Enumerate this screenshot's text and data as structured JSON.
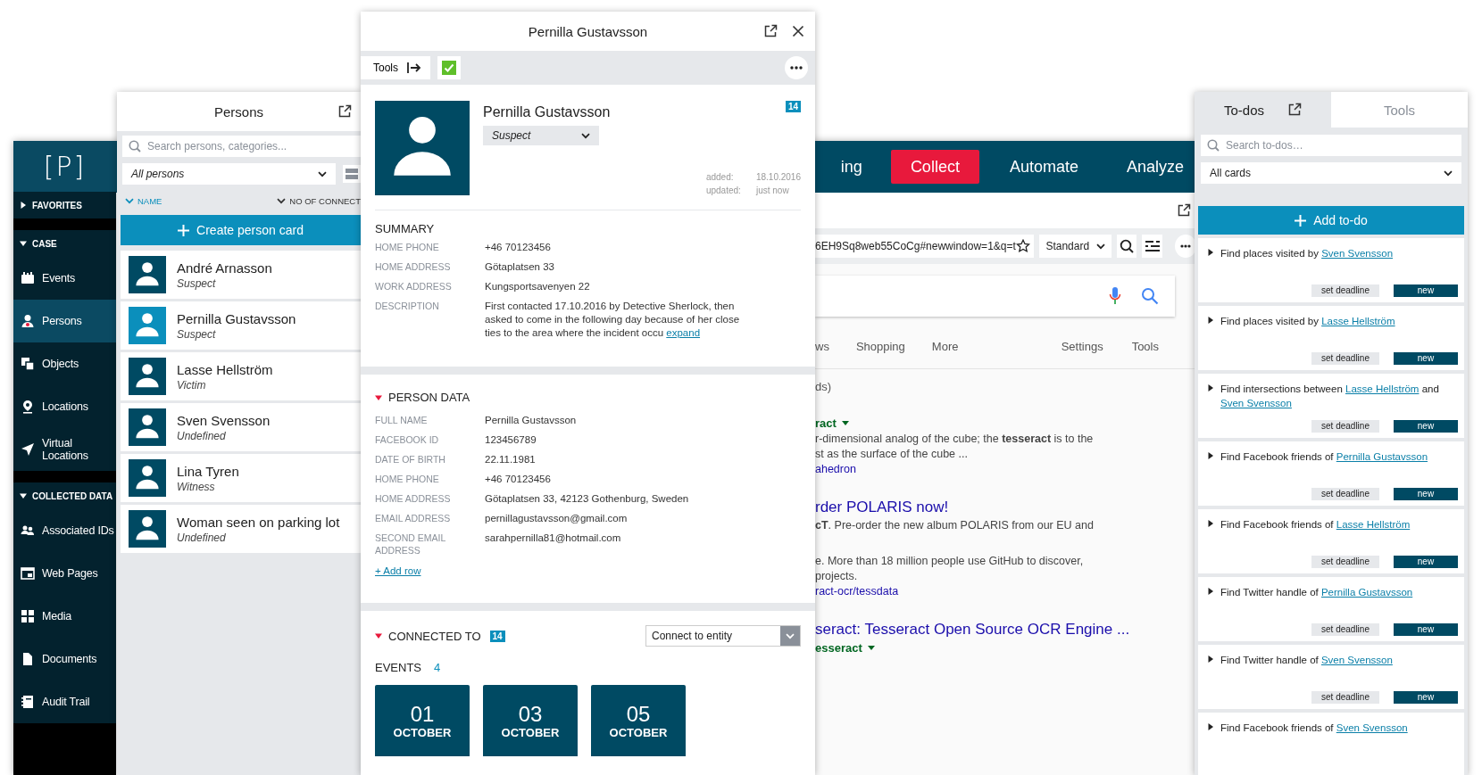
{
  "app": {
    "logo": "[P]",
    "sidebar": [
      {
        "title": "FAVORITES",
        "expanded": false
      },
      {
        "title": "CASE",
        "expanded": true,
        "items": [
          {
            "label": "Events",
            "selected": false
          },
          {
            "label": "Persons",
            "selected": true
          },
          {
            "label": "Objects",
            "selected": false
          },
          {
            "label": "Locations",
            "selected": false
          },
          {
            "label": "Virtual Locations",
            "selected": false
          }
        ]
      },
      {
        "title": "COLLECTED DATA",
        "expanded": true,
        "items": [
          {
            "label": "Associated IDs",
            "selected": false
          },
          {
            "label": "Web Pages",
            "selected": false
          },
          {
            "label": "Media",
            "selected": false
          },
          {
            "label": "Documents",
            "selected": false
          },
          {
            "label": "Audit Trail",
            "selected": false
          }
        ]
      }
    ],
    "nav": [
      {
        "label": "ing",
        "selected": false
      },
      {
        "label": "Collect",
        "selected": true
      },
      {
        "label": "Automate",
        "selected": false
      },
      {
        "label": "Analyze",
        "selected": false
      }
    ]
  },
  "browser": {
    "url": "6EH9Sq8web55CoCg#newwindow=1&q=t",
    "view": "Standard",
    "search_tabs": [
      "ws",
      "Shopping",
      "More"
    ],
    "search_tools": [
      "Settings",
      "Tools"
    ],
    "results": [
      [
        {
          "kind": "meta",
          "text": "ds)"
        }
      ],
      [
        {
          "kind": "site",
          "text": "ract"
        },
        {
          "kind": "snippet",
          "text": "r-dimensional analog of the cube; the **tesseract** is to the"
        },
        {
          "kind": "snippet",
          "text": "st as the surface of the cube ..."
        },
        {
          "kind": "link",
          "text": "ahedron"
        }
      ],
      [
        {
          "kind": "title",
          "text": "rder POLARIS now!"
        },
        {
          "kind": "snippet",
          "text": "**cT**. Pre-order the new album POLARIS from our EU and"
        }
      ],
      [
        {
          "kind": "snippet",
          "text": "e. More than 18 million people use GitHub to discover,"
        },
        {
          "kind": "snippet",
          "text": "projects."
        },
        {
          "kind": "link",
          "text": "ract-ocr/tessdata"
        }
      ],
      [
        {
          "kind": "title",
          "text": "seract: Tesseract Open Source OCR Engine ..."
        },
        {
          "kind": "site",
          "text": "esseract"
        }
      ]
    ]
  },
  "persons_window": {
    "title": "Persons",
    "search": {
      "placeholder": "Search persons, categories..."
    },
    "filter": "All persons",
    "sort": [
      {
        "label": "NAME",
        "active": true
      },
      {
        "label": "NO OF CONNECT",
        "active": false
      }
    ],
    "create_button": "Create person card",
    "persons": [
      {
        "name": "André Arnasson",
        "role": "Suspect",
        "selected": false
      },
      {
        "name": "Pernilla Gustavsson",
        "role": "Suspect",
        "selected": true
      },
      {
        "name": "Lasse Hellström",
        "role": "Victim",
        "selected": false
      },
      {
        "name": "Sven Svensson",
        "role": "Undefined",
        "selected": false
      },
      {
        "name": "Lina Tyren",
        "role": "Witness",
        "selected": false
      },
      {
        "name": "Woman seen on parking lot",
        "role": "Undefined",
        "selected": false
      }
    ]
  },
  "person_window": {
    "title": "Pernilla Gustavsson",
    "tools_button": "Tools",
    "checked": true,
    "name": "Pernilla Gustavsson",
    "category": "Suspect",
    "badge": "14",
    "meta": [
      {
        "label": "added:",
        "value": "18.10.2016"
      },
      {
        "label": "updated:",
        "value": "just now"
      }
    ],
    "summary": {
      "title": "SUMMARY",
      "rows": [
        {
          "label": "HOME PHONE",
          "value": "+46 70123456"
        },
        {
          "label": "HOME ADDRESS",
          "value": "Götaplatsen 33"
        },
        {
          "label": "WORK ADDRESS",
          "value": "Kungsportsavenyen 22"
        }
      ],
      "description": {
        "label": "DESCRIPTION",
        "text": "First contacted 17.10.2016 by Detective Sherlock, then asked to come in the following day because of her close ties to the area where the incident occu",
        "link": "expand"
      }
    },
    "person_data": {
      "title": "PERSON DATA",
      "expanded": true,
      "rows": [
        {
          "label": "FULL NAME",
          "value": "Pernilla Gustavsson"
        },
        {
          "label": "FACEBOOK ID",
          "value": "123456789"
        },
        {
          "label": "DATE OF BIRTH",
          "value": "22.11.1981"
        },
        {
          "label": "HOME PHONE",
          "value": "+46 70123456"
        },
        {
          "label": "HOME ADDRESS",
          "value": "Götaplatsen 33, 42123 Gothenburg, Sweden"
        },
        {
          "label": "EMAIL ADDRESS",
          "value": "pernillagustavsson@gmail.com"
        },
        {
          "label": "SECOND EMAIL ADDRESS",
          "value": "sarahpernilla81@hotmail.com"
        }
      ],
      "add_row": "+ Add row"
    },
    "connected": {
      "title": "CONNECTED TO",
      "expanded": true,
      "count": "14",
      "connect_select": "Connect to entity"
    },
    "events": {
      "title": "EVENTS",
      "count": "4",
      "tiles": [
        {
          "day": "01",
          "month": "OCTOBER"
        },
        {
          "day": "03",
          "month": "OCTOBER"
        },
        {
          "day": "05",
          "month": "OCTOBER"
        }
      ]
    }
  },
  "todos_window": {
    "tabs": [
      {
        "label": "To-dos",
        "selected": true
      },
      {
        "label": "Tools",
        "selected": false
      }
    ],
    "search": {
      "placeholder": "Search to-dos…"
    },
    "filter": "All cards",
    "add_button": "Add to-do",
    "todos": [
      {
        "expanded": false,
        "parts": [
          {
            "text": "Find places visited by "
          },
          {
            "link": "Sven Svensson"
          }
        ],
        "deadline": "set deadline",
        "status": "new"
      },
      {
        "expanded": false,
        "parts": [
          {
            "text": "Find places visited by "
          },
          {
            "link": "Lasse Hellström"
          }
        ],
        "deadline": "set deadline",
        "status": "new"
      },
      {
        "expanded": false,
        "parts": [
          {
            "text": "Find intersections between "
          },
          {
            "link": "Lasse Hellström"
          },
          {
            "text": " and "
          },
          {
            "link": "Sven Svensson"
          }
        ],
        "deadline": "set deadline",
        "status": "new"
      },
      {
        "expanded": false,
        "parts": [
          {
            "text": "Find Facebook friends of "
          },
          {
            "link": "Pernilla Gustavsson"
          }
        ],
        "deadline": "set deadline",
        "status": "new"
      },
      {
        "expanded": false,
        "parts": [
          {
            "text": "Find Facebook friends of "
          },
          {
            "link": "Lasse Hellström"
          }
        ],
        "deadline": "set deadline",
        "status": "new"
      },
      {
        "expanded": false,
        "parts": [
          {
            "text": "Find Twitter handle of "
          },
          {
            "link": "Pernilla Gustavsson"
          }
        ],
        "deadline": "set deadline",
        "status": "new"
      },
      {
        "expanded": false,
        "parts": [
          {
            "text": "Find Twitter handle of "
          },
          {
            "link": "Sven Svensson"
          }
        ],
        "deadline": "set deadline",
        "status": "new"
      },
      {
        "expanded": false,
        "parts": [
          {
            "text": "Find Facebook friends of "
          },
          {
            "link": "Sven Svensson"
          }
        ]
      }
    ]
  }
}
